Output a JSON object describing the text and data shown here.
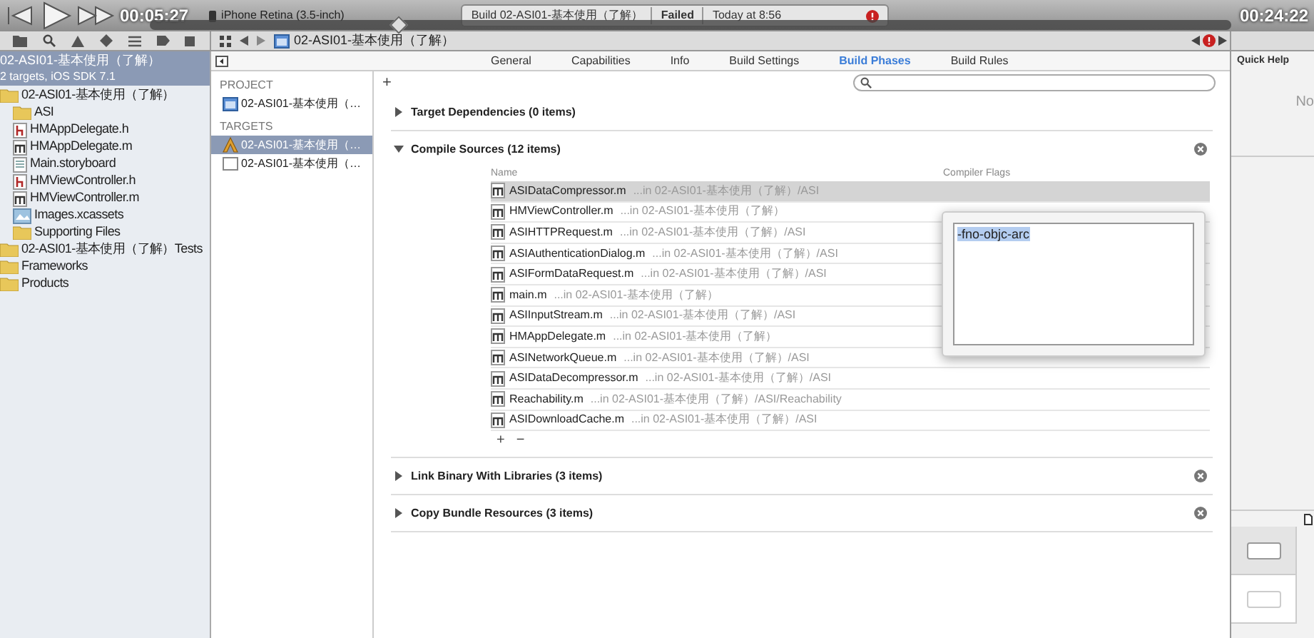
{
  "player": {
    "elapsed": "00:05:27",
    "remaining": "00:24:22",
    "level": 0.23
  },
  "toolbar": {
    "scheme": "iPhone Retina (3.5-inch)",
    "status_title": "Build 02-ASI01-基本使用（了解）",
    "status_result": "Failed",
    "status_time": "Today at 8:56"
  },
  "jump_bar": {
    "path": "02-ASI01-基本使用（了解）"
  },
  "navigator": {
    "project": {
      "title": "02-ASI01-基本使用（了解）",
      "subtitle": "2 targets, iOS SDK 7.1",
      "selected": true
    },
    "items": [
      {
        "label": "02-ASI01-基本使用（了解）",
        "kind": "folder",
        "children": [
          {
            "label": "ASI",
            "kind": "folder"
          },
          {
            "label": "HMAppDelegate.h",
            "kind": "h"
          },
          {
            "label": "HMAppDelegate.m",
            "kind": "m"
          },
          {
            "label": "Main.storyboard",
            "kind": "storyboard"
          },
          {
            "label": "HMViewController.h",
            "kind": "h"
          },
          {
            "label": "HMViewController.m",
            "kind": "m"
          },
          {
            "label": "Images.xcassets",
            "kind": "assets"
          },
          {
            "label": "Supporting Files",
            "kind": "folder"
          }
        ]
      },
      {
        "label": "02-ASI01-基本使用（了解）Tests",
        "kind": "folder"
      },
      {
        "label": "Frameworks",
        "kind": "folder"
      },
      {
        "label": "Products",
        "kind": "folder"
      }
    ]
  },
  "tabs": [
    {
      "label": "General",
      "selected": false
    },
    {
      "label": "Capabilities",
      "selected": false
    },
    {
      "label": "Info",
      "selected": false
    },
    {
      "label": "Build Settings",
      "selected": false
    },
    {
      "label": "Build Phases",
      "selected": true
    },
    {
      "label": "Build Rules",
      "selected": false
    }
  ],
  "project_list": {
    "project_heading": "PROJECT",
    "project": [
      {
        "label": "02-ASI01-基本使用（…",
        "kind": "project",
        "selected": false
      }
    ],
    "targets_heading": "TARGETS",
    "targets": [
      {
        "label": "02-ASI01-基本使用（…",
        "kind": "app",
        "selected": true
      },
      {
        "label": "02-ASI01-基本使用（…",
        "kind": "tests",
        "selected": false
      }
    ]
  },
  "phases": [
    {
      "title": "Target Dependencies (0 items)",
      "expanded": false,
      "removable": false
    },
    {
      "title": "Compile Sources (12 items)",
      "expanded": true,
      "removable": true,
      "columns": [
        "Name",
        "Compiler Flags"
      ],
      "rows": [
        {
          "name": "ASIDataCompressor.m",
          "path": "...in 02-ASI01-基本使用（了解）/ASI",
          "selected": true
        },
        {
          "name": "HMViewController.m",
          "path": "...in 02-ASI01-基本使用（了解）",
          "selected": false
        },
        {
          "name": "ASIHTTPRequest.m",
          "path": "...in 02-ASI01-基本使用（了解）/ASI",
          "selected": false
        },
        {
          "name": "ASIAuthenticationDialog.m",
          "path": "...in 02-ASI01-基本使用（了解）/ASI",
          "selected": false
        },
        {
          "name": "ASIFormDataRequest.m",
          "path": "...in 02-ASI01-基本使用（了解）/ASI",
          "selected": false
        },
        {
          "name": "main.m",
          "path": "...in 02-ASI01-基本使用（了解）",
          "selected": false
        },
        {
          "name": "ASIInputStream.m",
          "path": "...in 02-ASI01-基本使用（了解）/ASI",
          "selected": false
        },
        {
          "name": "HMAppDelegate.m",
          "path": "...in 02-ASI01-基本使用（了解）",
          "selected": false
        },
        {
          "name": "ASINetworkQueue.m",
          "path": "...in 02-ASI01-基本使用（了解）/ASI",
          "selected": false
        },
        {
          "name": "ASIDataDecompressor.m",
          "path": "...in 02-ASI01-基本使用（了解）/ASI",
          "selected": false
        },
        {
          "name": "Reachability.m",
          "path": "...in 02-ASI01-基本使用（了解）/ASI/Reachability",
          "selected": false
        },
        {
          "name": "ASIDownloadCache.m",
          "path": "...in 02-ASI01-基本使用（了解）/ASI",
          "selected": false
        }
      ],
      "add": "+",
      "remove": "−"
    },
    {
      "title": "Link Binary With Libraries (3 items)",
      "expanded": false,
      "removable": true
    },
    {
      "title": "Copy Bundle Resources (3 items)",
      "expanded": false,
      "removable": true
    }
  ],
  "flags_popover": {
    "value": "-fno-objc-arc"
  },
  "add_phase": "+",
  "inspector": {
    "title": "Quick Help",
    "message": "No"
  }
}
